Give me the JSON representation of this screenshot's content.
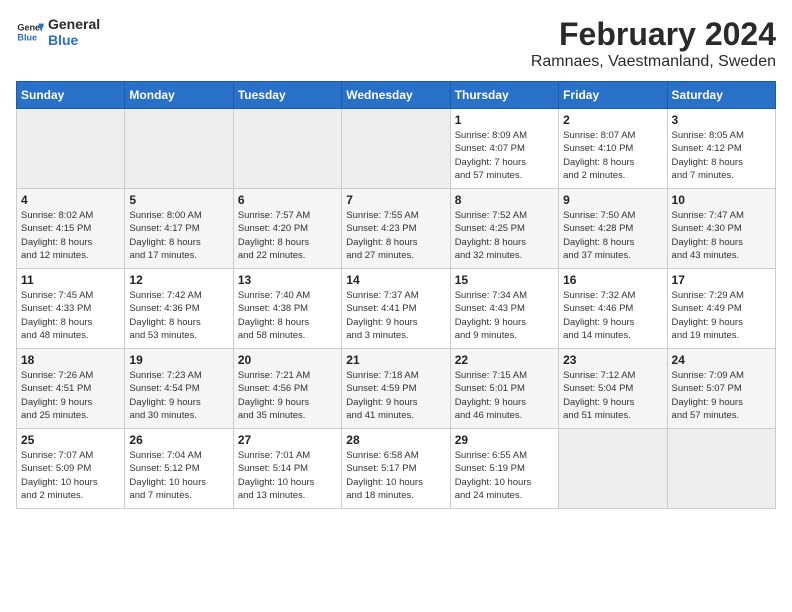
{
  "header": {
    "logo_line1": "General",
    "logo_line2": "Blue",
    "title": "February 2024",
    "subtitle": "Ramnaes, Vaestmanland, Sweden"
  },
  "columns": [
    "Sunday",
    "Monday",
    "Tuesday",
    "Wednesday",
    "Thursday",
    "Friday",
    "Saturday"
  ],
  "weeks": [
    [
      {
        "day": "",
        "info": ""
      },
      {
        "day": "",
        "info": ""
      },
      {
        "day": "",
        "info": ""
      },
      {
        "day": "",
        "info": ""
      },
      {
        "day": "1",
        "info": "Sunrise: 8:09 AM\nSunset: 4:07 PM\nDaylight: 7 hours\nand 57 minutes."
      },
      {
        "day": "2",
        "info": "Sunrise: 8:07 AM\nSunset: 4:10 PM\nDaylight: 8 hours\nand 2 minutes."
      },
      {
        "day": "3",
        "info": "Sunrise: 8:05 AM\nSunset: 4:12 PM\nDaylight: 8 hours\nand 7 minutes."
      }
    ],
    [
      {
        "day": "4",
        "info": "Sunrise: 8:02 AM\nSunset: 4:15 PM\nDaylight: 8 hours\nand 12 minutes."
      },
      {
        "day": "5",
        "info": "Sunrise: 8:00 AM\nSunset: 4:17 PM\nDaylight: 8 hours\nand 17 minutes."
      },
      {
        "day": "6",
        "info": "Sunrise: 7:57 AM\nSunset: 4:20 PM\nDaylight: 8 hours\nand 22 minutes."
      },
      {
        "day": "7",
        "info": "Sunrise: 7:55 AM\nSunset: 4:23 PM\nDaylight: 8 hours\nand 27 minutes."
      },
      {
        "day": "8",
        "info": "Sunrise: 7:52 AM\nSunset: 4:25 PM\nDaylight: 8 hours\nand 32 minutes."
      },
      {
        "day": "9",
        "info": "Sunrise: 7:50 AM\nSunset: 4:28 PM\nDaylight: 8 hours\nand 37 minutes."
      },
      {
        "day": "10",
        "info": "Sunrise: 7:47 AM\nSunset: 4:30 PM\nDaylight: 8 hours\nand 43 minutes."
      }
    ],
    [
      {
        "day": "11",
        "info": "Sunrise: 7:45 AM\nSunset: 4:33 PM\nDaylight: 8 hours\nand 48 minutes."
      },
      {
        "day": "12",
        "info": "Sunrise: 7:42 AM\nSunset: 4:36 PM\nDaylight: 8 hours\nand 53 minutes."
      },
      {
        "day": "13",
        "info": "Sunrise: 7:40 AM\nSunset: 4:38 PM\nDaylight: 8 hours\nand 58 minutes."
      },
      {
        "day": "14",
        "info": "Sunrise: 7:37 AM\nSunset: 4:41 PM\nDaylight: 9 hours\nand 3 minutes."
      },
      {
        "day": "15",
        "info": "Sunrise: 7:34 AM\nSunset: 4:43 PM\nDaylight: 9 hours\nand 9 minutes."
      },
      {
        "day": "16",
        "info": "Sunrise: 7:32 AM\nSunset: 4:46 PM\nDaylight: 9 hours\nand 14 minutes."
      },
      {
        "day": "17",
        "info": "Sunrise: 7:29 AM\nSunset: 4:49 PM\nDaylight: 9 hours\nand 19 minutes."
      }
    ],
    [
      {
        "day": "18",
        "info": "Sunrise: 7:26 AM\nSunset: 4:51 PM\nDaylight: 9 hours\nand 25 minutes."
      },
      {
        "day": "19",
        "info": "Sunrise: 7:23 AM\nSunset: 4:54 PM\nDaylight: 9 hours\nand 30 minutes."
      },
      {
        "day": "20",
        "info": "Sunrise: 7:21 AM\nSunset: 4:56 PM\nDaylight: 9 hours\nand 35 minutes."
      },
      {
        "day": "21",
        "info": "Sunrise: 7:18 AM\nSunset: 4:59 PM\nDaylight: 9 hours\nand 41 minutes."
      },
      {
        "day": "22",
        "info": "Sunrise: 7:15 AM\nSunset: 5:01 PM\nDaylight: 9 hours\nand 46 minutes."
      },
      {
        "day": "23",
        "info": "Sunrise: 7:12 AM\nSunset: 5:04 PM\nDaylight: 9 hours\nand 51 minutes."
      },
      {
        "day": "24",
        "info": "Sunrise: 7:09 AM\nSunset: 5:07 PM\nDaylight: 9 hours\nand 57 minutes."
      }
    ],
    [
      {
        "day": "25",
        "info": "Sunrise: 7:07 AM\nSunset: 5:09 PM\nDaylight: 10 hours\nand 2 minutes."
      },
      {
        "day": "26",
        "info": "Sunrise: 7:04 AM\nSunset: 5:12 PM\nDaylight: 10 hours\nand 7 minutes."
      },
      {
        "day": "27",
        "info": "Sunrise: 7:01 AM\nSunset: 5:14 PM\nDaylight: 10 hours\nand 13 minutes."
      },
      {
        "day": "28",
        "info": "Sunrise: 6:58 AM\nSunset: 5:17 PM\nDaylight: 10 hours\nand 18 minutes."
      },
      {
        "day": "29",
        "info": "Sunrise: 6:55 AM\nSunset: 5:19 PM\nDaylight: 10 hours\nand 24 minutes."
      },
      {
        "day": "",
        "info": ""
      },
      {
        "day": "",
        "info": ""
      }
    ]
  ]
}
